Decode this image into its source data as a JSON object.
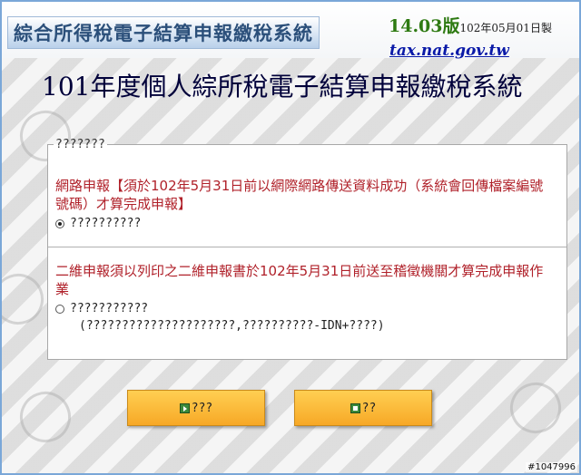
{
  "banner": {
    "title": "綜合所得稅電子結算申報繳稅系統",
    "version": "14.03版",
    "date": "102年05月01日製",
    "site": "tax.nat.gov.tw"
  },
  "main_title": "101年度個人綜所稅電子結算申報繳稅系統",
  "panel": {
    "legend": "???????",
    "option1": {
      "text": "網路申報【須於102年5月31日前以網際網路傳送資料成功（系統會回傳檔案編號號碼）才算完成申報】",
      "radio_label": "??????????",
      "selected": true
    },
    "option2": {
      "text": "二維申報須以列印之二維申報書於102年5月31日前送至稽徵機關才算完成申報作業",
      "radio_label": "???????????",
      "selected": false,
      "note": "(?????????????????????,??????????-IDN+????)"
    }
  },
  "buttons": {
    "next_label": "???",
    "exit_label": "??"
  },
  "watermark": "#1047996"
}
